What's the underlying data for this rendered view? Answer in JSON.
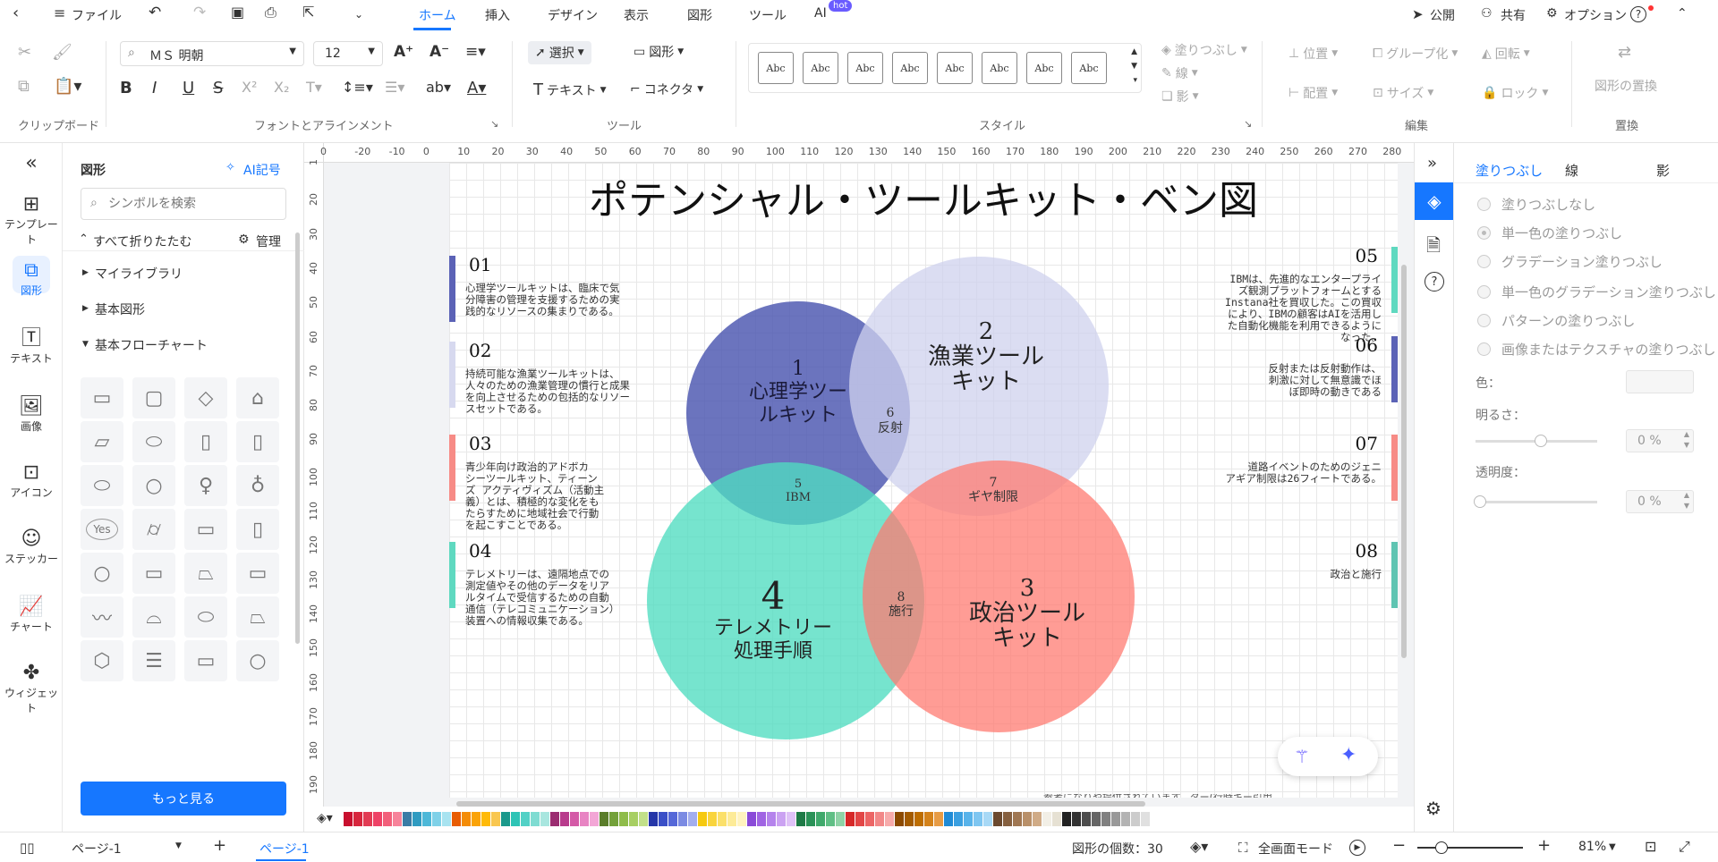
{
  "topbar": {
    "file": "ファイル",
    "tabs": [
      "ホーム",
      "挿入",
      "デザイン",
      "表示",
      "図形",
      "ツール",
      "AI"
    ],
    "hot_badge": "hot",
    "publish": "公開",
    "share": "共有",
    "options": "オプション",
    "help": "?"
  },
  "ribbon": {
    "clipboard_label": "クリップボード",
    "font_label": "フォントとアラインメント",
    "tools_label": "ツール",
    "style_label": "スタイル",
    "edit_label": "編集",
    "replace_label": "置換",
    "font_name": "ＭＳ 明朝",
    "font_size": "12",
    "select": "選択",
    "shape": "図形",
    "text": "テキスト",
    "connector": "コネクタ",
    "style_sample": "Abc",
    "fill": "塗りつぶし",
    "line": "線",
    "shadow": "影",
    "position": "位置",
    "group": "グループ化",
    "rotate": "回転",
    "align": "配置",
    "size": "サイズ",
    "lock": "ロック",
    "replace_shape": "図形の置換"
  },
  "leftnav": {
    "collapse": "«",
    "items": [
      {
        "label": "テンプレート",
        "icon": "template-icon"
      },
      {
        "label": "図形",
        "icon": "shapes-icon"
      },
      {
        "label": "テキスト",
        "icon": "text-icon"
      },
      {
        "label": "画像",
        "icon": "image-icon"
      },
      {
        "label": "アイコン",
        "icon": "icon-icon"
      },
      {
        "label": "ステッカー",
        "icon": "sticker-icon"
      },
      {
        "label": "チャート",
        "icon": "chart-icon"
      },
      {
        "label": "ウィジェット",
        "icon": "widget-icon"
      }
    ]
  },
  "shapes": {
    "title": "図形",
    "ai_symbol": "AI記号",
    "search_placeholder": "シンボルを検索",
    "collapse_all": "すべて折りたたむ",
    "manage": "管理",
    "libraries": [
      "マイライブラリ",
      "基本図形",
      "基本フローチャート"
    ],
    "yes_label": "Yes",
    "more": "もっと見る"
  },
  "ruler": {
    "top": [
      "0",
      "-20",
      "-10",
      "0",
      "10",
      "20",
      "30",
      "40",
      "50",
      "60",
      "70",
      "80",
      "90",
      "100",
      "110",
      "120",
      "130",
      "140",
      "150",
      "160",
      "170",
      "180",
      "190",
      "200",
      "210",
      "220",
      "230",
      "240",
      "250",
      "260",
      "270",
      "280"
    ],
    "left": [
      "1",
      "20",
      "30",
      "40",
      "50",
      "60",
      "70",
      "80",
      "90",
      "100",
      "110",
      "120",
      "130",
      "140",
      "150",
      "160",
      "170",
      "180",
      "190"
    ]
  },
  "diagram": {
    "title": "ポテンシャル・ツールキット・ベン図",
    "circles": [
      {
        "num": "1",
        "label1": "心理学ツー",
        "label2": "ルキット",
        "color": "#4a56b0"
      },
      {
        "num": "2",
        "label1": "漁業ツール",
        "label2": "キット",
        "color": "#cdd0ec"
      },
      {
        "num": "3",
        "label1": "政治ツール",
        "label2": "キット",
        "color": "#ff7b72"
      },
      {
        "num": "4",
        "label1": "テレメトリー",
        "label2": "処理手順",
        "color": "#4fdcc0"
      }
    ],
    "overlaps": [
      {
        "num": "5",
        "label": "IBM"
      },
      {
        "num": "6",
        "label": "反射"
      },
      {
        "num": "7",
        "label": "ギヤ制限"
      },
      {
        "num": "8",
        "label": "施行"
      }
    ],
    "notes": [
      {
        "num": "01",
        "lines": [
          "心理学ツールキットは、臨床で気",
          "分障害の管理を支援するための実",
          "践的なリソースの集まりである。"
        ],
        "color": "#5b62b6"
      },
      {
        "num": "02",
        "lines": [
          "持続可能な漁業ツールキットは、",
          "人々のための漁業管理の慣行と成果",
          "を向上させるための包括的なリソー",
          "スセットである。"
        ],
        "color": "#d7d9ef"
      },
      {
        "num": "03",
        "lines": [
          "青少年向け政治的アドボカ",
          "シーツールキット、ティーン",
          "ズ アクティヴィズム（活動主",
          "義）とは、積極的な変化をも",
          "たらすために地域社会で行動",
          "を起こすことである。"
        ],
        "color": "#f78b86"
      },
      {
        "num": "04",
        "lines": [
          "テレメトリーは、遠隔地点での",
          "測定値やその他のデータをリア",
          "ルタイムで受信するための自動",
          "通信（テレコミュニケーション）",
          "装置への情報収集である。"
        ],
        "color": "#5fd9c0"
      },
      {
        "num": "05",
        "lines": [
          "IBMは、先進的なエンタープライ",
          "ズ観測プラットフォームとする",
          "Instana社を買収した。この買収",
          "により、IBMの顧客はAIを活用し",
          "た自動化機能を利用できるように",
          "なった。"
        ],
        "color": "#5fd9c0"
      },
      {
        "num": "06",
        "lines": [
          "反射または反射動作は、",
          "刺激に対して無意識でほ",
          "ぼ即時の動きである"
        ],
        "color": "#5b62b6"
      },
      {
        "num": "07",
        "lines": [
          "道路イベントのためのジェニ",
          "アギア制限は26フィートである。"
        ],
        "color": "#f78b86"
      },
      {
        "num": "08",
        "lines": [
          "政治と施行"
        ],
        "color": "#5fc4b2"
      }
    ],
    "footnote": "参考になりや提供されています。ター(行時キー引用"
  },
  "props": {
    "tabs": [
      "塗りつぶし",
      "線",
      "影"
    ],
    "options": [
      "塗りつぶしなし",
      "単一色の塗りつぶし",
      "グラデーション塗りつぶし",
      "単一色のグラデーション塗りつぶし",
      "パターンの塗りつぶし",
      "画像またはテクスチャの塗りつぶし"
    ],
    "color_label": "色：",
    "brightness_label": "明るさ：",
    "brightness_value": "0 %",
    "transparency_label": "透明度：",
    "transparency_value": "0 %"
  },
  "palette": [
    "#c8102e",
    "#d7263d",
    "#e23b53",
    "#ee4266",
    "#f25f7a",
    "#f7839a",
    "#3a7ca5",
    "#2f9bc1",
    "#4db8d8",
    "#7fd1e8",
    "#a8e3f0",
    "#e85d04",
    "#f48c06",
    "#faa307",
    "#ffba08",
    "#f9c74f",
    "#1b998b",
    "#2ec4b6",
    "#52d1c6",
    "#7fdcd2",
    "#a8e6df",
    "#9b2d71",
    "#b83b8c",
    "#d45aa7",
    "#e884c3",
    "#f3a6d6",
    "#5a7d2a",
    "#73a13a",
    "#8fbc4a",
    "#a7cf62",
    "#c2e089",
    "#2536a8",
    "#3a4fc7",
    "#5568d8",
    "#7b8be3",
    "#a3aeee",
    "#f6c90e",
    "#f9d43c",
    "#fbe06a",
    "#fdeb97",
    "#fff3bf",
    "#8a4ad8",
    "#a064e3",
    "#b583ec",
    "#cba2f2",
    "#dfc2f7",
    "#1e7a46",
    "#2a9257",
    "#3fa96b",
    "#60bf85",
    "#8fd3a6",
    "#d62828",
    "#e24646",
    "#ec6565",
    "#f28888",
    "#f7abab",
    "#8c4a00",
    "#a35b00",
    "#bd6d00",
    "#d4821a",
    "#e79c45",
    "#1f8bd6",
    "#3a9fe0",
    "#58b3ea",
    "#7ec6f1",
    "#a8d9f6",
    "#6b4a2f",
    "#86603f",
    "#a07752",
    "#b99069",
    "#d0ab86",
    "#f2efe6",
    "#e6e1d3",
    "#222222",
    "#333333",
    "#4d4d4d",
    "#666666",
    "#808080",
    "#999999",
    "#b3b3b3",
    "#cccccc",
    "#e0e0e0"
  ],
  "status": {
    "page_select": "ページ-1",
    "page_tab": "ページ-1",
    "shape_count": "図形の個数：30",
    "fullscreen": "全画面モード",
    "zoom": "81%"
  }
}
